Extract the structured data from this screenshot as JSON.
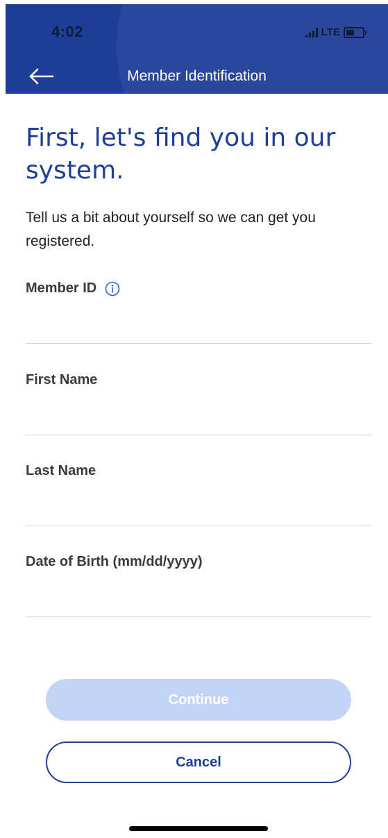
{
  "status_bar": {
    "time": "4:02",
    "network": "LTE"
  },
  "nav": {
    "title": "Member Identification",
    "back_icon": "arrow-left-icon"
  },
  "main": {
    "heading": "First, let's find you in our system.",
    "subtitle": "Tell us a bit about yourself so we can get you registered."
  },
  "form": {
    "member_id": {
      "label": "Member ID",
      "value": "",
      "info_icon": "info-icon"
    },
    "first_name": {
      "label": "First Name",
      "value": ""
    },
    "last_name": {
      "label": "Last Name",
      "value": ""
    },
    "dob": {
      "label": "Date of Birth (mm/dd/yyyy)",
      "value": ""
    }
  },
  "buttons": {
    "continue_label": "Continue",
    "cancel_label": "Cancel"
  },
  "colors": {
    "brand_blue": "#1f3f96",
    "disabled_button": "#c3d4f6"
  }
}
